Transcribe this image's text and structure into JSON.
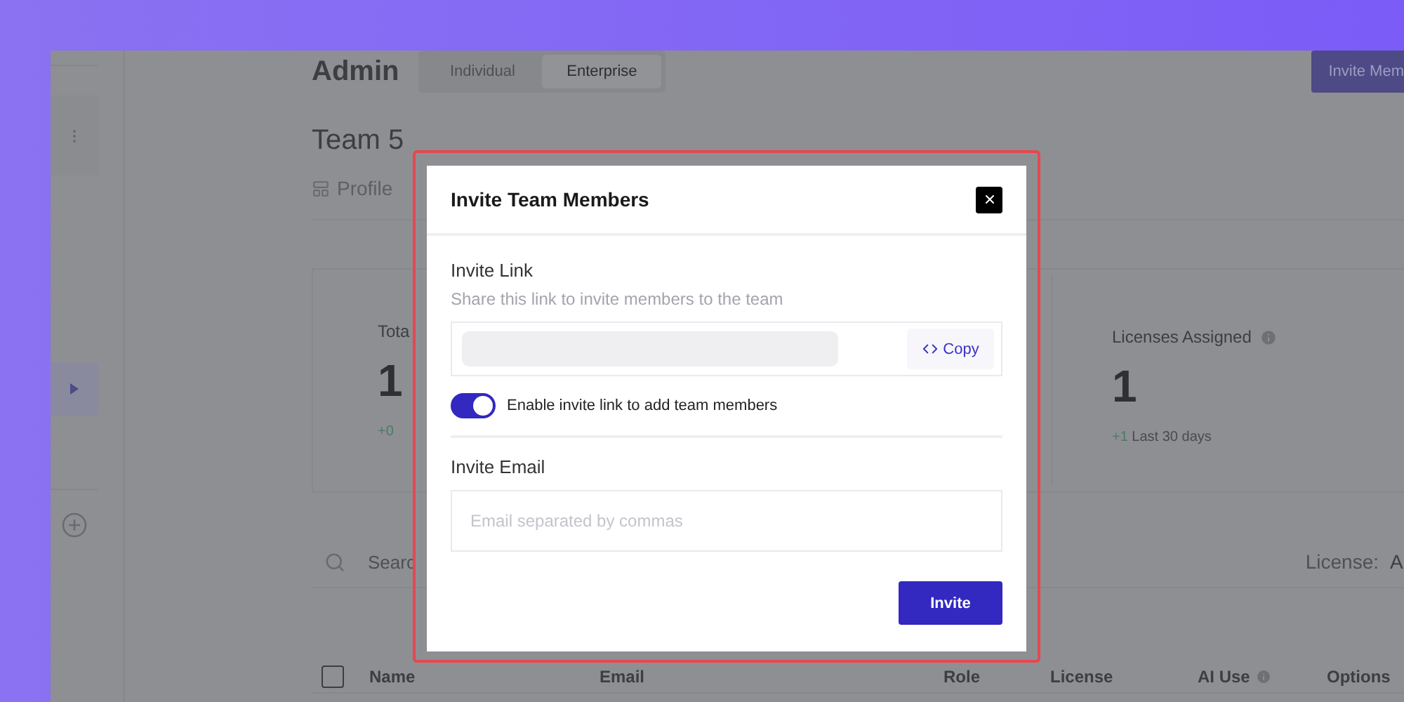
{
  "header": {
    "title": "Admin",
    "segments": [
      {
        "label": "Individual",
        "selected": false
      },
      {
        "label": "Enterprise",
        "selected": true
      }
    ],
    "invite_button": "Invite Mem"
  },
  "team": {
    "name": "Team 5",
    "tabs": [
      {
        "label": "Profile",
        "selected": false
      }
    ]
  },
  "stats": [
    {
      "label": "Tota",
      "value": "1",
      "delta": "+0",
      "info": false
    },
    {
      "label": "Licenses Assigned",
      "value": "1",
      "delta": "+1",
      "delta_label": "Last 30 days",
      "info": true
    }
  ],
  "search": {
    "placeholder": "Searc"
  },
  "filter": {
    "label": "License:",
    "value": "A"
  },
  "table": {
    "select_all": {
      "checked": false
    },
    "columns": [
      {
        "label": "Name",
        "info": false
      },
      {
        "label": "Email",
        "info": false
      },
      {
        "label": "Role",
        "info": false
      },
      {
        "label": "License",
        "info": false
      },
      {
        "label": "AI Use",
        "info": true
      },
      {
        "label": "Options",
        "info": false
      }
    ]
  },
  "modal": {
    "title": "Invite Team Members",
    "link": {
      "label": "Invite Link",
      "hint": "Share this link to invite members to the team",
      "copy_button": "Copy"
    },
    "toggle": {
      "label": "Enable invite link to add team members",
      "on": true
    },
    "email": {
      "label": "Invite Email",
      "placeholder": "Email separated by commas"
    },
    "submit": "Invite"
  }
}
